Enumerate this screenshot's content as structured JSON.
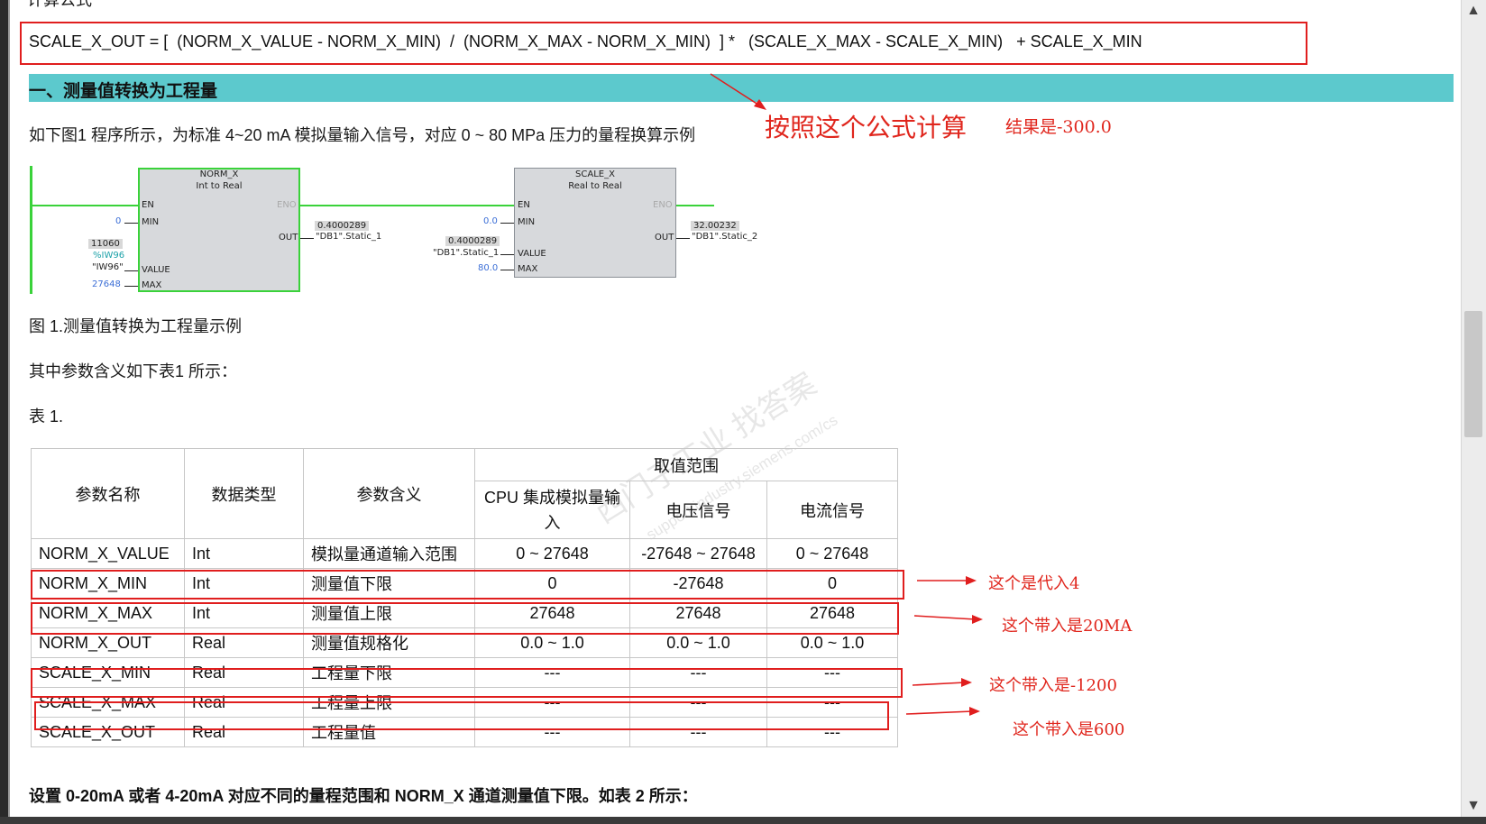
{
  "top_cut_text": "计算公式",
  "formula": "SCALE_X_OUT = [  (NORM_X_VALUE - NORM_X_MIN)  /  (NORM_X_MAX - NORM_X_MIN)  ] *   (SCALE_X_MAX - SCALE_X_MIN)   + SCALE_X_MIN",
  "section_title": "一、测量值转换为工程量",
  "intro": "如下图1 程序所示，为标准 4~20 mA 模拟量输入信号，对应 0 ~ 80 MPa 压力的量程换算示例",
  "annotations": {
    "main": "按照这个公式计算",
    "result": "结果是-300.0",
    "norm_min": "这个是代入4",
    "norm_max": "这个带入是20MA",
    "scale_min": "这个带入是-1200",
    "scale_max": "这个带入是600"
  },
  "ladder": {
    "norm_block": {
      "title": "NORM_X",
      "subtitle": "Int  to  Real",
      "en": "EN",
      "eno": "ENO",
      "min": "MIN",
      "value": "VALUE",
      "max": "MAX",
      "out": "OUT",
      "min_val": "0",
      "value_val": "11060",
      "value_addr": "%IW96",
      "value_tag": "\"IW96\"",
      "max_val": "27648",
      "out_val": "0.4000289",
      "out_tag": "\"DB1\".Static_1"
    },
    "scale_block": {
      "title": "SCALE_X",
      "subtitle": "Real  to  Real",
      "en": "EN",
      "eno": "ENO",
      "min": "MIN",
      "value": "VALUE",
      "max": "MAX",
      "out": "OUT",
      "min_val": "0.0",
      "value_val": "0.4000289",
      "value_tag": "\"DB1\".Static_1",
      "max_val": "80.0",
      "out_val": "32.00232",
      "out_tag": "\"DB1\".Static_2"
    }
  },
  "figure_caption": "图 1.测量值转换为工程量示例",
  "table_intro": "其中参数含义如下表1 所示：",
  "table_label": "表 1.",
  "table": {
    "headers": {
      "name": "参数名称",
      "type": "数据类型",
      "meaning": "参数含义",
      "range": "取值范围",
      "cpu": "CPU 集成模拟量输入",
      "voltage": "电压信号",
      "current": "电流信号"
    },
    "rows": [
      [
        "NORM_X_VALUE",
        "Int",
        "模拟量通道输入范围",
        "0 ~ 27648",
        "-27648 ~ 27648",
        "0 ~ 27648"
      ],
      [
        "NORM_X_MIN",
        "Int",
        "测量值下限",
        "0",
        "-27648",
        "0"
      ],
      [
        "NORM_X_MAX",
        "Int",
        "测量值上限",
        "27648",
        "27648",
        "27648"
      ],
      [
        "NORM_X_OUT",
        "Real",
        "测量值规格化",
        "0.0 ~ 1.0",
        "0.0 ~ 1.0",
        "0.0 ~ 1.0"
      ],
      [
        "SCALE_X_MIN",
        "Real",
        "工程量下限",
        "---",
        "---",
        "---"
      ],
      [
        "SCALE_X_MAX",
        "Real",
        "工程量上限",
        "---",
        "---",
        "---"
      ],
      [
        "SCALE_X_OUT",
        "Real",
        "工程量值",
        "---",
        "---",
        "---"
      ]
    ]
  },
  "bottom_text": "设置 0-20mA 或者 4-20mA 对应不同的量程范围和 NORM_X 通道测量值下限。如表 2 所示：",
  "watermark": {
    "line1": "西门子工业  找答案",
    "line2": "support.industry.siemens.com/cs"
  },
  "scroll": {
    "up": "▲",
    "down": "▼"
  },
  "colors": {
    "highlight_red": "#e01e1e",
    "section_band": "#5cc9cd",
    "ladder_green": "#3ad23a"
  }
}
